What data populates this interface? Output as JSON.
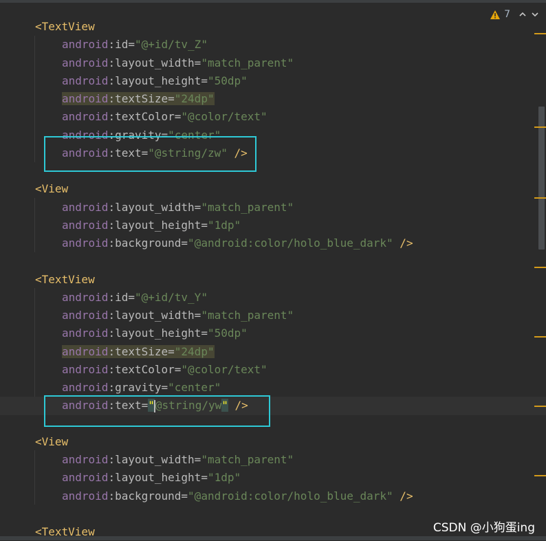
{
  "inspection": {
    "warning_count": "7"
  },
  "colors": {
    "background": "#2b2b2b",
    "tag": "#e8bf6a",
    "namespace": "#9876aa",
    "attribute": "#bababa",
    "value": "#6a8759",
    "highlight_box": "#2ec9d6",
    "marker": "#d49b1a"
  },
  "icons": [
    "warning-icon",
    "chevron-up-icon",
    "chevron-down-icon"
  ],
  "code": [
    {
      "indent": 0,
      "tag": "<TextView"
    },
    {
      "indent": 1,
      "ns": "android",
      "attr": "id",
      "value": "\"@+id/tv_Z\""
    },
    {
      "indent": 1,
      "ns": "android",
      "attr": "layout_width",
      "value": "\"match_parent\""
    },
    {
      "indent": 1,
      "ns": "android",
      "attr": "layout_height",
      "value": "\"50dp\""
    },
    {
      "indent": 1,
      "ns": "android",
      "attr": "textSize",
      "value": "\"24dp\"",
      "highlighted": true
    },
    {
      "indent": 1,
      "ns": "android",
      "attr": "textColor",
      "value": "\"@color/text\""
    },
    {
      "indent": 1,
      "ns": "android",
      "attr": "gravity",
      "value": "\"center\""
    },
    {
      "indent": 1,
      "ns": "android",
      "attr": "text",
      "value": "\"@string/zw\"",
      "close": " />"
    },
    {
      "indent": 0,
      "blank": true
    },
    {
      "indent": 0,
      "tag": "<View"
    },
    {
      "indent": 1,
      "ns": "android",
      "attr": "layout_width",
      "value": "\"match_parent\""
    },
    {
      "indent": 1,
      "ns": "android",
      "attr": "layout_height",
      "value": "\"1dp\""
    },
    {
      "indent": 1,
      "ns": "android",
      "attr": "background",
      "value": "\"@android:color/holo_blue_dark\"",
      "close": " />"
    },
    {
      "indent": 0,
      "blank": true
    },
    {
      "indent": 0,
      "tag": "<TextView"
    },
    {
      "indent": 1,
      "ns": "android",
      "attr": "id",
      "value": "\"@+id/tv_Y\""
    },
    {
      "indent": 1,
      "ns": "android",
      "attr": "layout_width",
      "value": "\"match_parent\""
    },
    {
      "indent": 1,
      "ns": "android",
      "attr": "layout_height",
      "value": "\"50dp\""
    },
    {
      "indent": 1,
      "ns": "android",
      "attr": "textSize",
      "value": "\"24dp\"",
      "highlighted": true
    },
    {
      "indent": 1,
      "ns": "android",
      "attr": "textColor",
      "value": "\"@color/text\""
    },
    {
      "indent": 1,
      "ns": "android",
      "attr": "gravity",
      "value": "\"center\""
    },
    {
      "indent": 1,
      "ns": "android",
      "attr": "text",
      "value_parts": [
        "\"",
        "@string/yw",
        "\""
      ],
      "close": " />",
      "caret": true
    },
    {
      "indent": 0,
      "blank": true
    },
    {
      "indent": 0,
      "tag": "<View"
    },
    {
      "indent": 1,
      "ns": "android",
      "attr": "layout_width",
      "value": "\"match_parent\""
    },
    {
      "indent": 1,
      "ns": "android",
      "attr": "layout_height",
      "value": "\"1dp\""
    },
    {
      "indent": 1,
      "ns": "android",
      "attr": "background",
      "value": "\"@android:color/holo_blue_dark\"",
      "close": " />"
    },
    {
      "indent": 0,
      "blank": true
    },
    {
      "indent": 0,
      "tag": "<TextView"
    }
  ],
  "watermark": "CSDN @小狗蛋ing"
}
